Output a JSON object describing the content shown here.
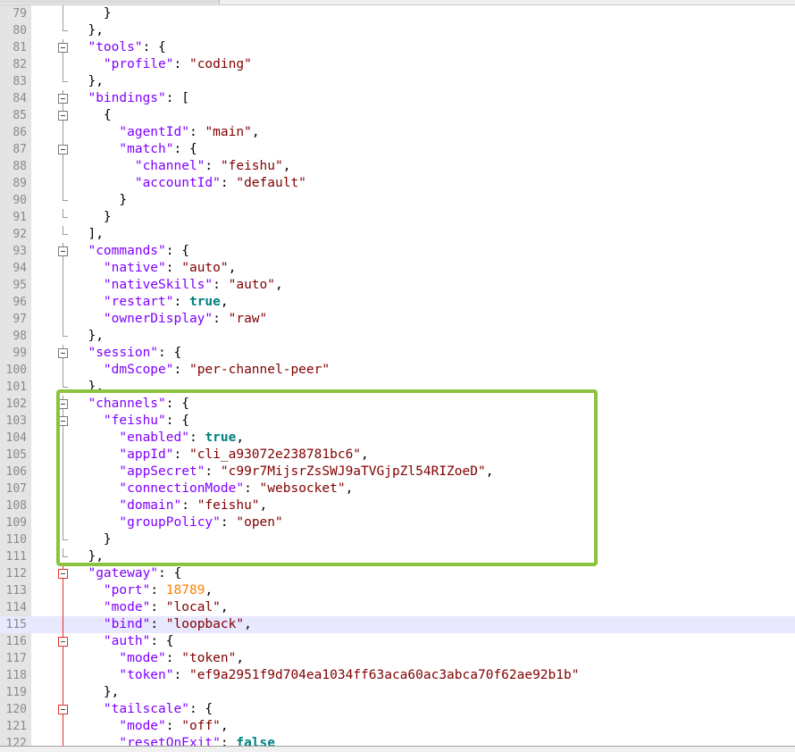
{
  "colors": {
    "key": "#8000ff",
    "string": "#800000",
    "boolean": "#008080",
    "number": "#ff8000",
    "punctuation": "#000000",
    "line_number": "#8a8a8a",
    "gutter": "#e4e4e4",
    "current_line": "#e8e8ff",
    "annotation_box": "#8ac43f",
    "fold_active": "#e03030"
  },
  "editor": {
    "current_line_number": "115",
    "annotation": "green rectangle around lines 102-111",
    "lines": [
      {
        "num": "79",
        "indent": 2,
        "fold": "line",
        "tokens": [
          {
            "t": "p",
            "v": "}"
          }
        ]
      },
      {
        "num": "80",
        "indent": 1,
        "fold": "end",
        "tokens": [
          {
            "t": "p",
            "v": "},"
          }
        ]
      },
      {
        "num": "81",
        "indent": 1,
        "fold": "box",
        "tokens": [
          {
            "t": "k",
            "v": "\"tools\""
          },
          {
            "t": "p",
            "v": ": {"
          }
        ]
      },
      {
        "num": "82",
        "indent": 2,
        "fold": "line",
        "tokens": [
          {
            "t": "k",
            "v": "\"profile\""
          },
          {
            "t": "p",
            "v": ": "
          },
          {
            "t": "s",
            "v": "\"coding\""
          }
        ]
      },
      {
        "num": "83",
        "indent": 1,
        "fold": "end",
        "tokens": [
          {
            "t": "p",
            "v": "},"
          }
        ]
      },
      {
        "num": "84",
        "indent": 1,
        "fold": "box",
        "tokens": [
          {
            "t": "k",
            "v": "\"bindings\""
          },
          {
            "t": "p",
            "v": ": ["
          }
        ]
      },
      {
        "num": "85",
        "indent": 2,
        "fold": "box",
        "tokens": [
          {
            "t": "p",
            "v": "{"
          }
        ]
      },
      {
        "num": "86",
        "indent": 3,
        "fold": "line",
        "tokens": [
          {
            "t": "k",
            "v": "\"agentId\""
          },
          {
            "t": "p",
            "v": ": "
          },
          {
            "t": "s",
            "v": "\"main\""
          },
          {
            "t": "p",
            "v": ","
          }
        ]
      },
      {
        "num": "87",
        "indent": 3,
        "fold": "box",
        "tokens": [
          {
            "t": "k",
            "v": "\"match\""
          },
          {
            "t": "p",
            "v": ": {"
          }
        ]
      },
      {
        "num": "88",
        "indent": 4,
        "fold": "line",
        "tokens": [
          {
            "t": "k",
            "v": "\"channel\""
          },
          {
            "t": "p",
            "v": ": "
          },
          {
            "t": "s",
            "v": "\"feishu\""
          },
          {
            "t": "p",
            "v": ","
          }
        ]
      },
      {
        "num": "89",
        "indent": 4,
        "fold": "line",
        "tokens": [
          {
            "t": "k",
            "v": "\"accountId\""
          },
          {
            "t": "p",
            "v": ": "
          },
          {
            "t": "s",
            "v": "\"default\""
          }
        ]
      },
      {
        "num": "90",
        "indent": 3,
        "fold": "end",
        "tokens": [
          {
            "t": "p",
            "v": "}"
          }
        ]
      },
      {
        "num": "91",
        "indent": 2,
        "fold": "end",
        "tokens": [
          {
            "t": "p",
            "v": "}"
          }
        ]
      },
      {
        "num": "92",
        "indent": 1,
        "fold": "end",
        "tokens": [
          {
            "t": "p",
            "v": "],"
          }
        ]
      },
      {
        "num": "93",
        "indent": 1,
        "fold": "box",
        "tokens": [
          {
            "t": "k",
            "v": "\"commands\""
          },
          {
            "t": "p",
            "v": ": {"
          }
        ]
      },
      {
        "num": "94",
        "indent": 2,
        "fold": "line",
        "tokens": [
          {
            "t": "k",
            "v": "\"native\""
          },
          {
            "t": "p",
            "v": ": "
          },
          {
            "t": "s",
            "v": "\"auto\""
          },
          {
            "t": "p",
            "v": ","
          }
        ]
      },
      {
        "num": "95",
        "indent": 2,
        "fold": "line",
        "tokens": [
          {
            "t": "k",
            "v": "\"nativeSkills\""
          },
          {
            "t": "p",
            "v": ": "
          },
          {
            "t": "s",
            "v": "\"auto\""
          },
          {
            "t": "p",
            "v": ","
          }
        ]
      },
      {
        "num": "96",
        "indent": 2,
        "fold": "line",
        "tokens": [
          {
            "t": "k",
            "v": "\"restart\""
          },
          {
            "t": "p",
            "v": ": "
          },
          {
            "t": "b",
            "v": "true"
          },
          {
            "t": "p",
            "v": ","
          }
        ]
      },
      {
        "num": "97",
        "indent": 2,
        "fold": "line",
        "tokens": [
          {
            "t": "k",
            "v": "\"ownerDisplay\""
          },
          {
            "t": "p",
            "v": ": "
          },
          {
            "t": "s",
            "v": "\"raw\""
          }
        ]
      },
      {
        "num": "98",
        "indent": 1,
        "fold": "end",
        "tokens": [
          {
            "t": "p",
            "v": "},"
          }
        ]
      },
      {
        "num": "99",
        "indent": 1,
        "fold": "box",
        "tokens": [
          {
            "t": "k",
            "v": "\"session\""
          },
          {
            "t": "p",
            "v": ": {"
          }
        ]
      },
      {
        "num": "100",
        "indent": 2,
        "fold": "line",
        "tokens": [
          {
            "t": "k",
            "v": "\"dmScope\""
          },
          {
            "t": "p",
            "v": ": "
          },
          {
            "t": "s",
            "v": "\"per-channel-peer\""
          }
        ]
      },
      {
        "num": "101",
        "indent": 1,
        "fold": "end",
        "tokens": [
          {
            "t": "p",
            "v": "},"
          }
        ]
      },
      {
        "num": "102",
        "indent": 1,
        "fold": "box",
        "tokens": [
          {
            "t": "k",
            "v": "\"channels\""
          },
          {
            "t": "p",
            "v": ": {"
          }
        ]
      },
      {
        "num": "103",
        "indent": 2,
        "fold": "box",
        "tokens": [
          {
            "t": "k",
            "v": "\"feishu\""
          },
          {
            "t": "p",
            "v": ": {"
          }
        ]
      },
      {
        "num": "104",
        "indent": 3,
        "fold": "line",
        "tokens": [
          {
            "t": "k",
            "v": "\"enabled\""
          },
          {
            "t": "p",
            "v": ": "
          },
          {
            "t": "b",
            "v": "true"
          },
          {
            "t": "p",
            "v": ","
          }
        ]
      },
      {
        "num": "105",
        "indent": 3,
        "fold": "line",
        "tokens": [
          {
            "t": "k",
            "v": "\"appId\""
          },
          {
            "t": "p",
            "v": ": "
          },
          {
            "t": "s",
            "v": "\"cli_a93072e238781bc6\""
          },
          {
            "t": "p",
            "v": ","
          }
        ]
      },
      {
        "num": "106",
        "indent": 3,
        "fold": "line",
        "tokens": [
          {
            "t": "k",
            "v": "\"appSecret\""
          },
          {
            "t": "p",
            "v": ": "
          },
          {
            "t": "s",
            "v": "\"c99r7MijsrZsSWJ9aTVGjpZl54RIZoeD\""
          },
          {
            "t": "p",
            "v": ","
          }
        ]
      },
      {
        "num": "107",
        "indent": 3,
        "fold": "line",
        "tokens": [
          {
            "t": "k",
            "v": "\"connectionMode\""
          },
          {
            "t": "p",
            "v": ": "
          },
          {
            "t": "s",
            "v": "\"websocket\""
          },
          {
            "t": "p",
            "v": ","
          }
        ]
      },
      {
        "num": "108",
        "indent": 3,
        "fold": "line",
        "tokens": [
          {
            "t": "k",
            "v": "\"domain\""
          },
          {
            "t": "p",
            "v": ": "
          },
          {
            "t": "s",
            "v": "\"feishu\""
          },
          {
            "t": "p",
            "v": ","
          }
        ]
      },
      {
        "num": "109",
        "indent": 3,
        "fold": "line",
        "tokens": [
          {
            "t": "k",
            "v": "\"groupPolicy\""
          },
          {
            "t": "p",
            "v": ": "
          },
          {
            "t": "s",
            "v": "\"open\""
          }
        ]
      },
      {
        "num": "110",
        "indent": 2,
        "fold": "end",
        "tokens": [
          {
            "t": "p",
            "v": "}"
          }
        ]
      },
      {
        "num": "111",
        "indent": 1,
        "fold": "end",
        "tokens": [
          {
            "t": "p",
            "v": "},"
          }
        ]
      },
      {
        "num": "112",
        "indent": 1,
        "fold": "box-red",
        "tokens": [
          {
            "t": "k",
            "v": "\"gateway\""
          },
          {
            "t": "p",
            "v": ": {"
          }
        ]
      },
      {
        "num": "113",
        "indent": 2,
        "fold": "line-red",
        "tokens": [
          {
            "t": "k",
            "v": "\"port\""
          },
          {
            "t": "p",
            "v": ": "
          },
          {
            "t": "n",
            "v": "18789"
          },
          {
            "t": "p",
            "v": ","
          }
        ]
      },
      {
        "num": "114",
        "indent": 2,
        "fold": "line-red",
        "tokens": [
          {
            "t": "k",
            "v": "\"mode\""
          },
          {
            "t": "p",
            "v": ": "
          },
          {
            "t": "s",
            "v": "\"local\""
          },
          {
            "t": "p",
            "v": ","
          }
        ]
      },
      {
        "num": "115",
        "indent": 2,
        "fold": "line-red",
        "current": true,
        "tokens": [
          {
            "t": "k",
            "v": "\"bind\""
          },
          {
            "t": "p",
            "v": ": "
          },
          {
            "t": "s",
            "v": "\"loopback\""
          },
          {
            "t": "p",
            "v": ","
          }
        ]
      },
      {
        "num": "116",
        "indent": 2,
        "fold": "box-red",
        "tokens": [
          {
            "t": "k",
            "v": "\"auth\""
          },
          {
            "t": "p",
            "v": ": {"
          }
        ]
      },
      {
        "num": "117",
        "indent": 3,
        "fold": "line-red",
        "tokens": [
          {
            "t": "k",
            "v": "\"mode\""
          },
          {
            "t": "p",
            "v": ": "
          },
          {
            "t": "s",
            "v": "\"token\""
          },
          {
            "t": "p",
            "v": ","
          }
        ]
      },
      {
        "num": "118",
        "indent": 3,
        "fold": "line-red",
        "tokens": [
          {
            "t": "k",
            "v": "\"token\""
          },
          {
            "t": "p",
            "v": ": "
          },
          {
            "t": "s",
            "v": "\"ef9a2951f9d704ea1034ff63aca60ac3abca70f62ae92b1b\""
          }
        ]
      },
      {
        "num": "119",
        "indent": 2,
        "fold": "line-red",
        "tokens": [
          {
            "t": "p",
            "v": "},"
          }
        ]
      },
      {
        "num": "120",
        "indent": 2,
        "fold": "box-red",
        "tokens": [
          {
            "t": "k",
            "v": "\"tailscale\""
          },
          {
            "t": "p",
            "v": ": {"
          }
        ]
      },
      {
        "num": "121",
        "indent": 3,
        "fold": "line-red",
        "tokens": [
          {
            "t": "k",
            "v": "\"mode\""
          },
          {
            "t": "p",
            "v": ": "
          },
          {
            "t": "s",
            "v": "\"off\""
          },
          {
            "t": "p",
            "v": ","
          }
        ]
      },
      {
        "num": "122",
        "indent": 3,
        "fold": "line-red",
        "tokens": [
          {
            "t": "k",
            "v": "\"resetOnExit\""
          },
          {
            "t": "p",
            "v": ": "
          },
          {
            "t": "b",
            "v": "false"
          }
        ]
      }
    ]
  }
}
